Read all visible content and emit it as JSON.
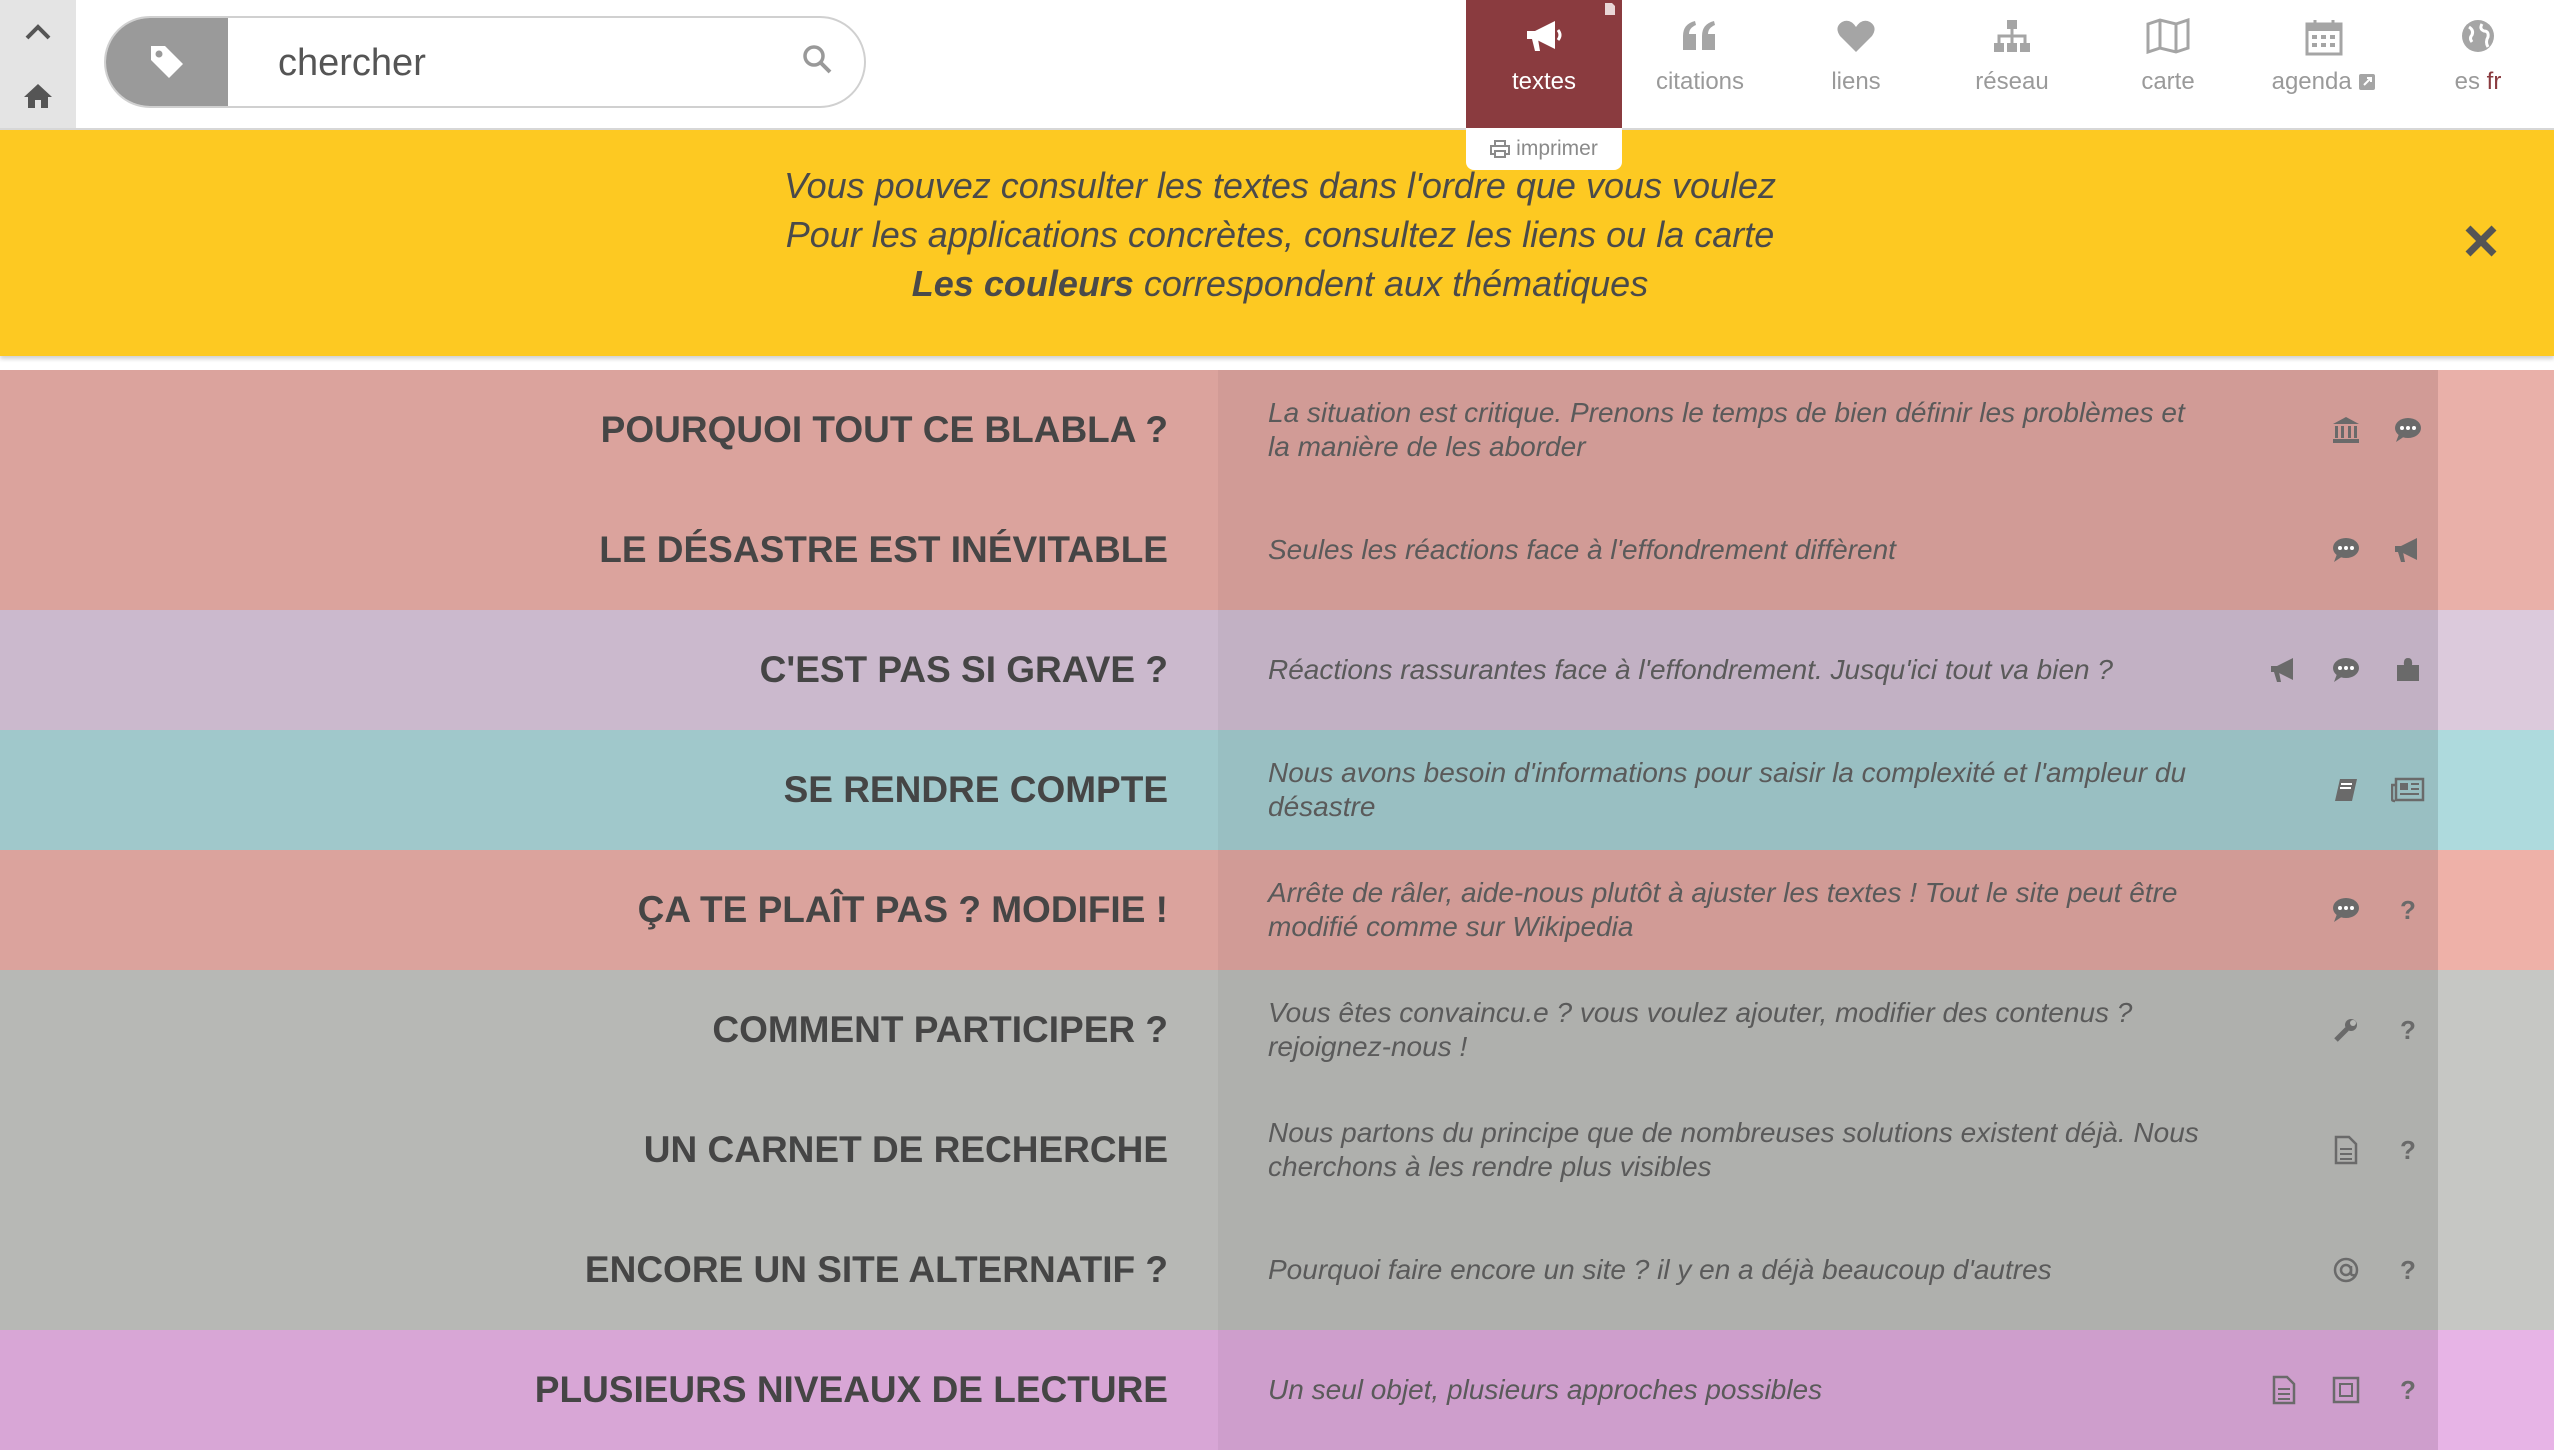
{
  "search": {
    "placeholder": "chercher"
  },
  "nav": [
    {
      "key": "textes",
      "label": "textes",
      "icon": "megaphone-icon",
      "active": true
    },
    {
      "key": "citations",
      "label": "citations",
      "icon": "quote-icon",
      "active": false
    },
    {
      "key": "liens",
      "label": "liens",
      "icon": "heart-icon",
      "active": false
    },
    {
      "key": "reseau",
      "label": "réseau",
      "icon": "network-icon",
      "active": false
    },
    {
      "key": "carte",
      "label": "carte",
      "icon": "map-icon",
      "active": false
    },
    {
      "key": "agenda",
      "label": "agenda",
      "icon": "calendar-icon",
      "active": false
    },
    {
      "key": "lang",
      "label": "es",
      "label_active": "fr",
      "icon": "globe-icon",
      "active": false
    }
  ],
  "print_label": "imprimer",
  "banner": {
    "line1": "Vous pouvez consulter les textes dans l'ordre que vous voulez",
    "line2": "Pour les applications concrètes, consultez les liens ou la carte",
    "line3_bold": "Les couleurs",
    "line3_rest": " correspondent aux thématiques"
  },
  "colors": {
    "active_nav": "#8a3b3f",
    "banner": "#fdc922",
    "red_theme": "#dba39d",
    "purple_theme": "#cbb9cd",
    "teal_theme": "#a0c8cb",
    "gray_theme": "#b7b8b5",
    "pink_theme": "#d8a6d6"
  },
  "rows": [
    {
      "title": "POURQUOI TOUT CE BLABLA ?",
      "desc": "La situation est critique. Prenons le temps de bien définir les problèmes et la manière de les aborder",
      "color": "#dba39d",
      "edge": "#e9b0a9",
      "icons": [
        "bank-icon",
        "comment-icon"
      ]
    },
    {
      "title": "LE DÉSASTRE EST INÉVITABLE",
      "desc": "Seules les réactions face à l'effondrement diffèrent",
      "color": "#dba39d",
      "edge": "#e9b0a9",
      "icons": [
        "comment-icon",
        "megaphone-icon"
      ]
    },
    {
      "title": "C'EST PAS SI GRAVE ?",
      "desc": "Réactions rassurantes face à l'effondrement. Jusqu'ici tout va bien ?",
      "color": "#cbb9cd",
      "edge": "#dccadc",
      "icons": [
        "megaphone-icon",
        "comment-icon",
        "puzzle-icon"
      ]
    },
    {
      "title": "SE RENDRE COMPTE",
      "desc": "Nous avons besoin d'informations pour saisir la complexité et l'ampleur du désastre",
      "color": "#a0c8cb",
      "edge": "#aedadd",
      "icons": [
        "book-icon",
        "newspaper-icon"
      ]
    },
    {
      "title": "ÇA TE PLAÎT PAS ? MODIFIE !",
      "desc": "Arrête de râler, aide-nous plutôt à ajuster les textes ! Tout le site peut être modifié comme sur Wikipedia",
      "color": "#dba39d",
      "edge": "#eeb1a8",
      "icons": [
        "comment-icon",
        "question-icon"
      ]
    },
    {
      "title": "COMMENT PARTICIPER ?",
      "desc": "Vous êtes convaincu.e ? vous voulez ajouter, modifier des contenus ? rejoignez-nous !",
      "color": "#b7b8b5",
      "edge": "#c6c7c4",
      "icons": [
        "wrench-icon",
        "question-icon"
      ]
    },
    {
      "title": "UN CARNET DE RECHERCHE",
      "desc": "Nous partons du principe que de nombreuses solutions existent déjà. Nous cherchons à les rendre plus visibles",
      "color": "#b7b8b5",
      "edge": "#c6c7c4",
      "icons": [
        "document-icon",
        "question-icon"
      ]
    },
    {
      "title": "ENCORE UN SITE ALTERNATIF ?",
      "desc": "Pourquoi faire encore un site ? il y en a déjà beaucoup d'autres",
      "color": "#b7b8b5",
      "edge": "#c6c7c4",
      "icons": [
        "at-icon",
        "question-icon"
      ]
    },
    {
      "title": "PLUSIEURS NIVEAUX DE LECTURE",
      "desc": "Un seul objet, plusieurs approches possibles",
      "color": "#d8a6d6",
      "edge": "#e7b4e6",
      "icons": [
        "document-icon",
        "frame-icon",
        "question-icon"
      ]
    }
  ]
}
